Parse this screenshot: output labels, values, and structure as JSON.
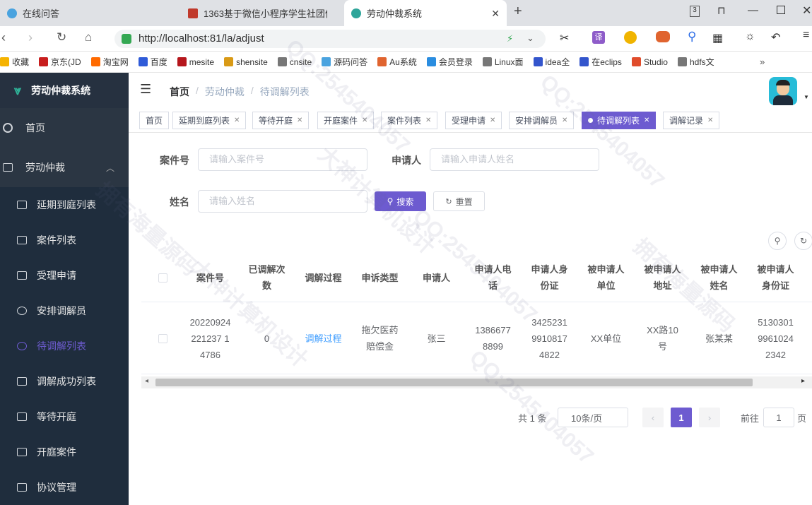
{
  "browser": {
    "tabs": [
      {
        "label": "在线问答",
        "color": "#4aa3df"
      },
      {
        "label": "1363基于微信小程序学生社团信",
        "color": "#c0392b"
      },
      {
        "label": "劳动仲裁系统",
        "color": "#2fa59a"
      }
    ],
    "url": "http://localhost:81/la/adjust",
    "bookmarks": [
      "收藏",
      "京东(JD",
      "淘宝网",
      "百度",
      "mesite",
      "shensite",
      "cnsite",
      "源码问答",
      "Au系统",
      "会员登录",
      "Linux面",
      "idea全",
      "在eclips",
      "Studio",
      "hdfs文"
    ]
  },
  "sidebar": {
    "title": "劳动仲裁系统",
    "items": [
      {
        "label": "首页"
      },
      {
        "label": "劳动仲裁",
        "arrow": "︿"
      },
      {
        "label": "延期到庭列表"
      },
      {
        "label": "案件列表"
      },
      {
        "label": "受理申请"
      },
      {
        "label": "安排调解员"
      },
      {
        "label": "待调解列表",
        "active": true
      },
      {
        "label": "调解成功列表"
      },
      {
        "label": "等待开庭"
      },
      {
        "label": "开庭案件"
      },
      {
        "label": "协议管理"
      }
    ]
  },
  "header": {
    "breadcrumb": [
      "首页",
      "劳动仲裁",
      "待调解列表"
    ]
  },
  "tags": [
    "首页",
    "延期到庭列表",
    "等待开庭",
    "开庭案件",
    "案件列表",
    "受理申请",
    "安排调解员",
    "待调解列表",
    "调解记录"
  ],
  "search": {
    "case_label": "案件号",
    "case_placeholder": "请输入案件号",
    "applicant_label": "申请人",
    "applicant_placeholder": "请输入申请人姓名",
    "name_label": "姓名",
    "name_placeholder": "请输入姓名",
    "search_btn": "搜索",
    "reset_btn": "重置"
  },
  "table": {
    "headers": [
      "案件号",
      "已调解次数",
      "调解过程",
      "申诉类型",
      "申请人",
      "申请人电话",
      "申请人身份证",
      "被申请人单位",
      "被申请人地址",
      "被申请人姓名",
      "被申请人身份证"
    ],
    "rows": [
      [
        "20220924221237 14786",
        "0",
        "调解过程",
        "拖欠医药赔偿金",
        "张三",
        "13866778899",
        "342523199108174822",
        "XX单位",
        "XX路10号",
        "张某某",
        "513030199610242342"
      ]
    ]
  },
  "pagination": {
    "total": "共 1 条",
    "page_size": "10条/页",
    "current": "1",
    "goto_label": "前往",
    "goto_value": "1",
    "goto_suffix": "页"
  },
  "watermark": [
    "QQ:2545404057",
    "大神计算机设计",
    "拥有海量源码"
  ],
  "colors": {
    "accent": "#6d5bd0",
    "sidebar": "#2b3643",
    "link": "#409eff"
  }
}
